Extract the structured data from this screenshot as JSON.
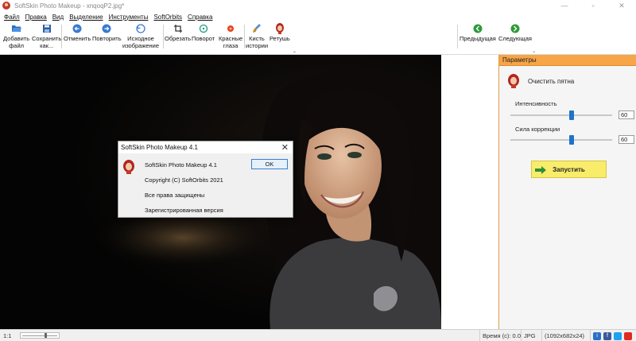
{
  "window": {
    "title": "SoftSkin Photo Makeup - xnqoqP2.jpg*",
    "controls": {
      "minimize": "—",
      "maximize": "▫",
      "close": "✕"
    }
  },
  "menu": [
    "Файл",
    "Правка",
    "Вид",
    "Выделение",
    "Инструменты",
    "SoftOrbits",
    "Справка"
  ],
  "toolbar": {
    "add_file": [
      "Добавить",
      "файл"
    ],
    "save_as": [
      "Сохранить",
      "как..."
    ],
    "undo": "Отменить",
    "redo": "Повторить",
    "original": [
      "Исходное",
      "изображение"
    ],
    "crop": "Обрезать",
    "rotate": "Поворот",
    "red_eye": [
      "Красные",
      "глаза"
    ],
    "history_brush": [
      "Кисть",
      "истории"
    ],
    "retouch": "Ретушь",
    "prev": "Предыдущая",
    "next": "Следующая",
    "chevron": "⌄"
  },
  "params": {
    "header": "Параметры",
    "tool": "Очистить пятна",
    "intensity_label": "Интенсивность",
    "intensity_value": "60",
    "intensity_level": 0.6,
    "correction_label": "Сила коррекции",
    "correction_value": "60",
    "correction_level": 0.6,
    "run_label": "Запустить"
  },
  "dialog": {
    "title": "SoftSkin Photo Makeup 4.1",
    "close": "✕",
    "lines": [
      "SoftSkin Photo Makeup 4.1",
      "Copyright (C) SoftOrbits 2021",
      "Все права защищены",
      "Зарегистрированная версия"
    ],
    "ok": "OK"
  },
  "status": {
    "zoom": "1:1",
    "time": "Время (с): 0.0",
    "format": "JPG",
    "dims": "(1092x682x24)"
  },
  "colors": {
    "accent": "#f6a548",
    "run_button": "#f8ec6a",
    "slider_thumb": "#1e73c9"
  }
}
